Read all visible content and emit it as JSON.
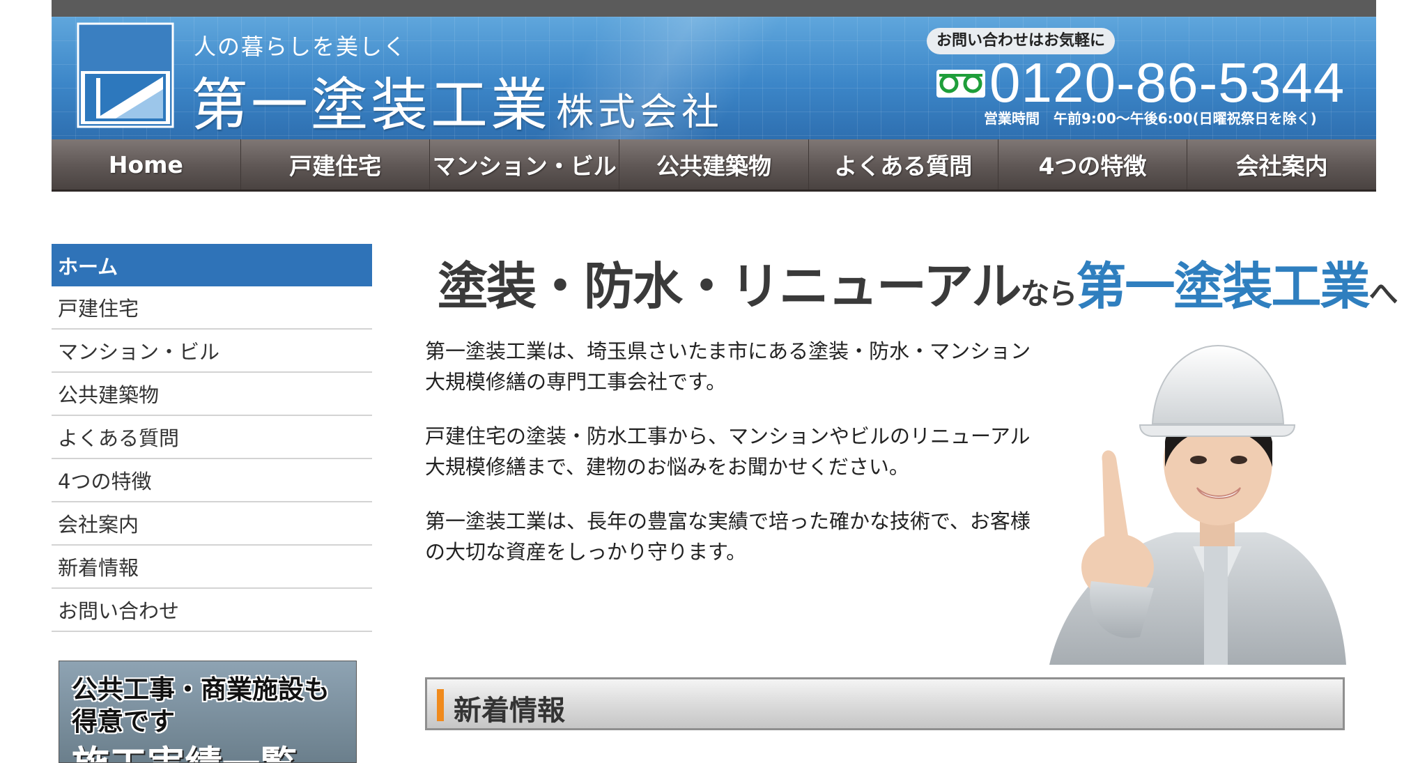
{
  "header": {
    "tagline": "人の暮らしを美しく",
    "company_name": "第一塗装工業",
    "company_suffix": "株式会社",
    "contact_pill": "お問い合わせはお気軽に",
    "phone": "0120-86-5344",
    "hours": "営業時間　午前9:00〜午後6:00(日曜祝祭日を除く)",
    "freedial_icon": "freedial-icon"
  },
  "nav": {
    "items": [
      "Home",
      "戸建住宅",
      "マンション・ビル",
      "公共建築物",
      "よくある質問",
      "4つの特徴",
      "会社案内"
    ]
  },
  "sidebar": {
    "items": [
      {
        "label": "ホーム",
        "active": true
      },
      {
        "label": "戸建住宅"
      },
      {
        "label": "マンション・ビル"
      },
      {
        "label": "公共建築物"
      },
      {
        "label": "よくある質問"
      },
      {
        "label": "4つの特徴"
      },
      {
        "label": "会社案内"
      },
      {
        "label": "新着情報"
      },
      {
        "label": "お問い合わせ"
      }
    ],
    "banner": {
      "line1": "公共工事・商業施設も",
      "line2": "得意です",
      "line3": "施工実績一覧"
    }
  },
  "main": {
    "hero": {
      "part1": "塗装・防水・リニューアル",
      "part2": "なら",
      "part3": "第一塗装工業",
      "part4": "へ"
    },
    "paragraphs": [
      [
        "第一塗装工業は、埼玉県さいたま市にある塗装・防水・マンション",
        "大規模修繕の専門工事会社です。"
      ],
      [
        "戸建住宅の塗装・防水工事から、マンションやビルのリニューアル",
        "大規模修繕まで、建物のお悩みをお聞かせください。"
      ],
      [
        "第一塗装工業は、長年の豊富な実績で培った確かな技術で、お客様",
        "の大切な資産をしっかり守ります。"
      ]
    ],
    "news_heading": "新着情報"
  },
  "colors": {
    "header_blue": "#3c86c8",
    "nav_brown": "#5e5654",
    "sidebar_active": "#2f73b8",
    "hero_blue": "#2f7fbf",
    "accent_orange": "#f08a1c"
  }
}
